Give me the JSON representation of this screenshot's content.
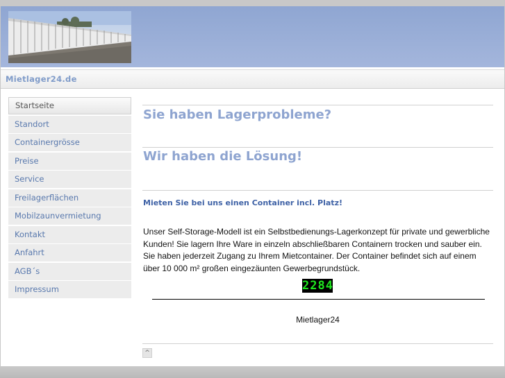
{
  "site": {
    "name": "Mietlager24.de"
  },
  "nav": {
    "items": [
      {
        "label": "Startseite"
      },
      {
        "label": "Standort"
      },
      {
        "label": "Containergrösse"
      },
      {
        "label": "Preise"
      },
      {
        "label": "Service"
      },
      {
        "label": "Freilagerflächen"
      },
      {
        "label": "Mobilzaunvermietung"
      },
      {
        "label": "Kontakt"
      },
      {
        "label": "Anfahrt"
      },
      {
        "label": "AGB´s"
      },
      {
        "label": "Impressum"
      }
    ],
    "active_index": 0
  },
  "main": {
    "heading1": "Sie haben Lagerprobleme?",
    "heading2": "Wir haben die Lösung!",
    "subheading": "Mieten Sie bei uns einen Container incl. Platz!",
    "paragraph": "Unser Self-Storage-Modell ist ein Selbstbedienungs-Lagerkonzept für private und gewerbliche Kunden! Sie lagern Ihre Ware in einzeln abschließbaren Containern trocken und sauber ein. Sie haben jederzeit Zugang zu Ihrem Mietcontainer. Der Container befindet sich auf einem über 10 000 m² großen eingezäunten Gewerbegrundstück.",
    "counter": "2284",
    "footer_name": "Mietlager24"
  },
  "back_to_top": {
    "symbol": "^"
  },
  "colors": {
    "header_blue": "#9eb2da",
    "heading_blue": "#8ea4d0",
    "link_blue": "#5878ad",
    "counter_green": "#1fe61f"
  }
}
